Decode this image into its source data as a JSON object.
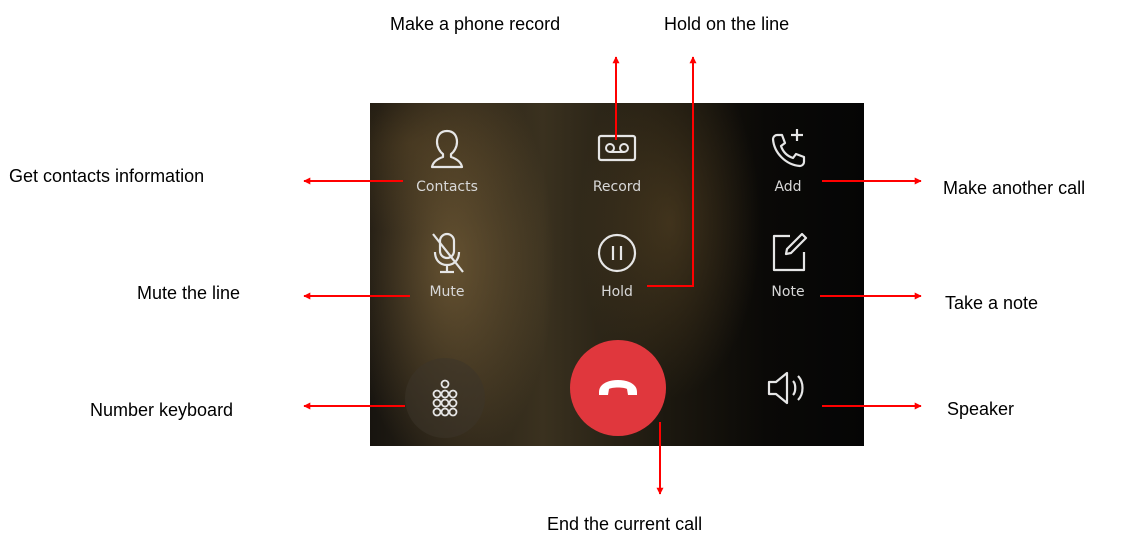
{
  "colors": {
    "annotation_arrow": "#ff0000",
    "end_call_button": "#e0373d",
    "icon_stroke": "#e6e6e6"
  },
  "controls": {
    "contacts": {
      "label": "Contacts",
      "icon": "person-icon"
    },
    "record": {
      "label": "Record",
      "icon": "cassette-icon"
    },
    "add": {
      "label": "Add",
      "icon": "phone-plus-icon"
    },
    "mute": {
      "label": "Mute",
      "icon": "microphone-slash-icon"
    },
    "hold": {
      "label": "Hold",
      "icon": "pause-circle-icon"
    },
    "note": {
      "label": "Note",
      "icon": "pencil-square-icon"
    },
    "keypad": {
      "icon": "dialpad-icon"
    },
    "end_call": {
      "icon": "phone-hangup-icon"
    },
    "speaker": {
      "icon": "speaker-icon"
    }
  },
  "annotations": {
    "record": "Make a phone record",
    "hold": "Hold on the line",
    "contacts": "Get contacts information",
    "add": "Make another call",
    "mute": "Mute the line",
    "note": "Take a note",
    "keypad": "Number keyboard",
    "speaker": "Speaker",
    "end_call": "End the current call"
  }
}
